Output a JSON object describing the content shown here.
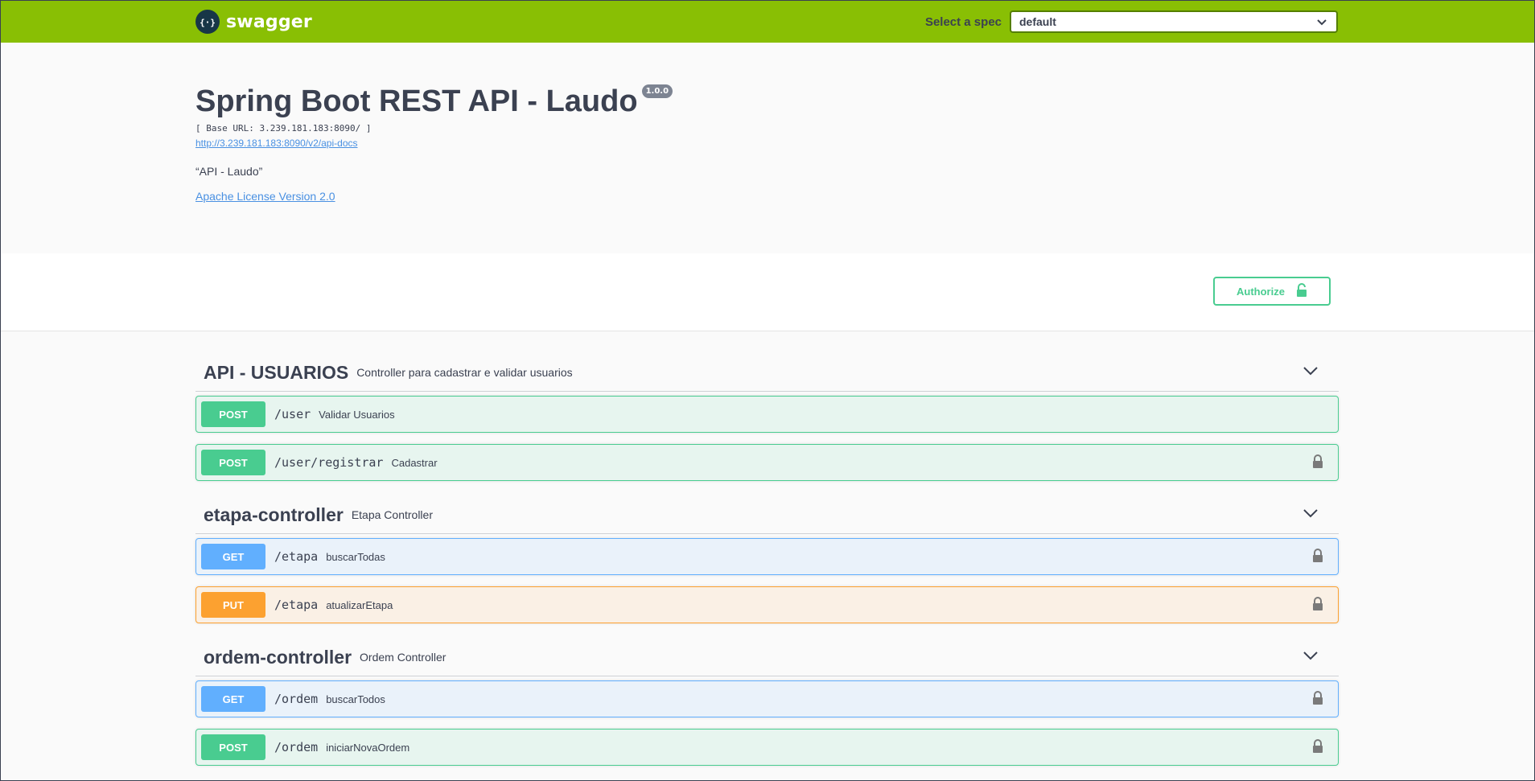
{
  "topbar": {
    "logo_text": "swagger",
    "spec_label": "Select a spec",
    "spec_value": "default"
  },
  "info": {
    "title": "Spring Boot REST API - Laudo",
    "version": "1.0.0",
    "base_url": "[ Base URL: 3.239.181.183:8090/ ]",
    "docs_link": "http://3.239.181.183:8090/v2/api-docs",
    "description": "“API - Laudo”",
    "license": "Apache License Version 2.0"
  },
  "authorize": {
    "label": "Authorize"
  },
  "tags": [
    {
      "name": "API - USUARIOS",
      "description": "Controller para cadastrar e validar usuarios",
      "operations": [
        {
          "method": "POST",
          "path": "/user",
          "summary": "Validar Usuarios",
          "locked": false
        },
        {
          "method": "POST",
          "path": "/user/registrar",
          "summary": "Cadastrar",
          "locked": true
        }
      ]
    },
    {
      "name": "etapa-controller",
      "description": "Etapa Controller",
      "operations": [
        {
          "method": "GET",
          "path": "/etapa",
          "summary": "buscarTodas",
          "locked": true
        },
        {
          "method": "PUT",
          "path": "/etapa",
          "summary": "atualizarEtapa",
          "locked": true
        }
      ]
    },
    {
      "name": "ordem-controller",
      "description": "Ordem Controller",
      "operations": [
        {
          "method": "GET",
          "path": "/ordem",
          "summary": "buscarTodos",
          "locked": true
        },
        {
          "method": "POST",
          "path": "/ordem",
          "summary": "iniciarNovaOrdem",
          "locked": true
        }
      ]
    }
  ],
  "colors": {
    "topbar": "#89bf04",
    "post": "#49cc90",
    "get": "#61affe",
    "put": "#fca130",
    "text": "#3b4151",
    "link": "#4990e2"
  }
}
